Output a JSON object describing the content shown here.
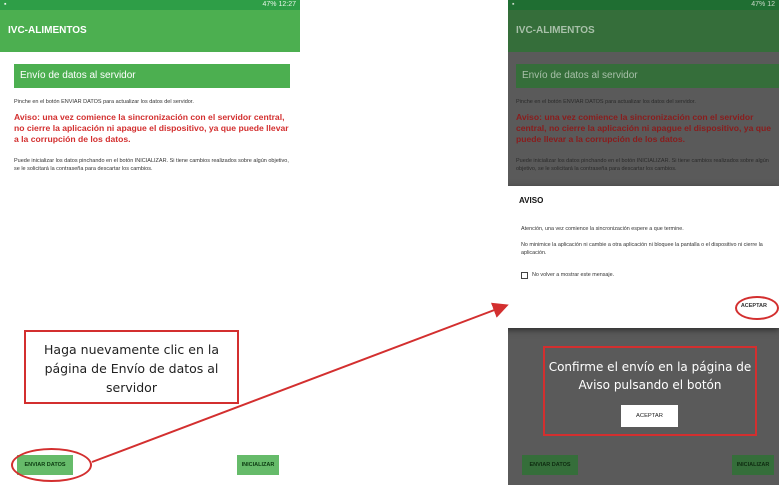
{
  "left": {
    "status": {
      "icon": "image-icon",
      "right": "47% 12:27"
    },
    "app_title": "IVC-ALIMENTOS",
    "section_title": "Envío de datos al servidor",
    "intro": "Pinche en el botón ENVIAR DATOS para actualizar los datos del servidor.",
    "warning": "Aviso: una vez comience la sincronización con el servidor central, no cierre la aplicación ni apague el dispositivo, ya que puede llevar a la corrupción de los datos.",
    "info": "Puede inicializar los datos pinchando en el botón INICIALIZAR. Si tiene cambios realizados sobre algún objetivo, se le solicitará la contraseña para descartar los cambios.",
    "send_button": "ENVIAR DATOS",
    "init_button": "INICIALIZAR"
  },
  "right": {
    "status": {
      "icon": "image-icon",
      "right": "47% 12"
    },
    "app_title": "IVC-ALIMENTOS",
    "section_title": "Envío de datos al servidor",
    "intro": "Pinche en el botón ENVIAR DATOS para actualizar los datos del servidor.",
    "warning": "Aviso: una vez comience la sincronización con el servidor central, no cierre la aplicación ni apague el dispositivo, ya que puede llevar a la corrupción de los datos.",
    "info": "Puede inicializar los datos pinchando en el botón INICIALIZAR. Si tiene cambios realizados sobre algún objetivo, se le solicitará la contraseña para descartar los cambios.",
    "send_button": "ENVIAR DATOS",
    "init_button": "INICIALIZAR",
    "dialog": {
      "title": "AVISO",
      "p1": "Atención, una vez comience la sincronización espere a que termine.",
      "p2": "No minimice la aplicación ni cambie a otra aplicación ni bloquee la pantalla o el dispositivo ni cierre la aplicación.",
      "checkbox_label": "No volver a mostrar este mensaje.",
      "accept": "ACEPTAR"
    }
  },
  "callouts": {
    "left_text": "Haga nuevamente clic en la página de Envío de datos al servidor",
    "right_text": "Confirme el envío en la página de Aviso pulsando el botón",
    "right_button": "ACEPTAR"
  },
  "colors": {
    "status_green": "#2e9e47",
    "app_green": "#4caf50",
    "warning_red": "#d32f2f",
    "annotation_red": "#d32f2f"
  }
}
